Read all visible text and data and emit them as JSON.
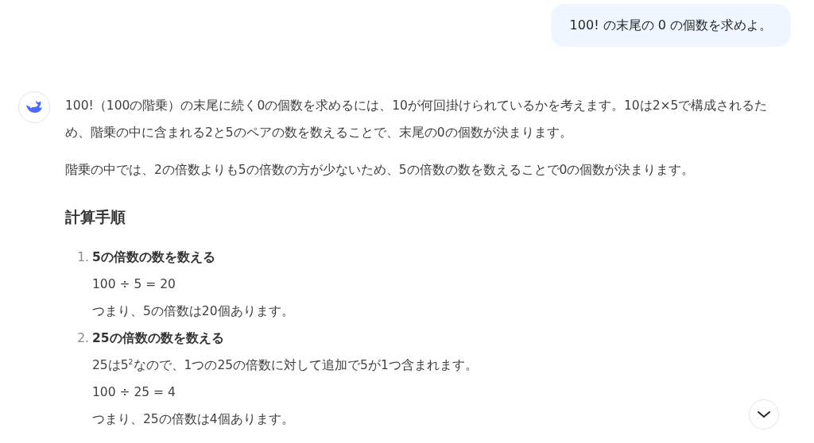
{
  "user_message": {
    "text": "100! の末尾の 0 の個数を求めよ。"
  },
  "assistant": {
    "paragraphs": [
      "100!（100の階乗）の末尾に続く0の個数を求めるには、10が何回掛けられているかを考えます。10は2×5で構成されるため、階乗の中に含まれる2と5のペアの数を数えることで、末尾の0の個数が決まります。",
      "階乗の中では、2の倍数よりも5の倍数の方が少ないため、5の倍数の数を数えることで0の個数が決まります。"
    ],
    "heading": "計算手順",
    "steps": [
      {
        "number": "1.",
        "title": "5の倍数の数を数える",
        "lines": [
          "100 ÷ 5 = 20",
          "つまり、5の倍数は20個あります。"
        ]
      },
      {
        "number": "2.",
        "title": "25の倍数の数を数える",
        "lines": [
          "25は5$^{2}$なので、1つの25の倍数に対して追加で5が1つ含まれます。",
          "100 ÷ 25 = 4",
          "つまり、25の倍数は4個あります。"
        ]
      }
    ]
  }
}
